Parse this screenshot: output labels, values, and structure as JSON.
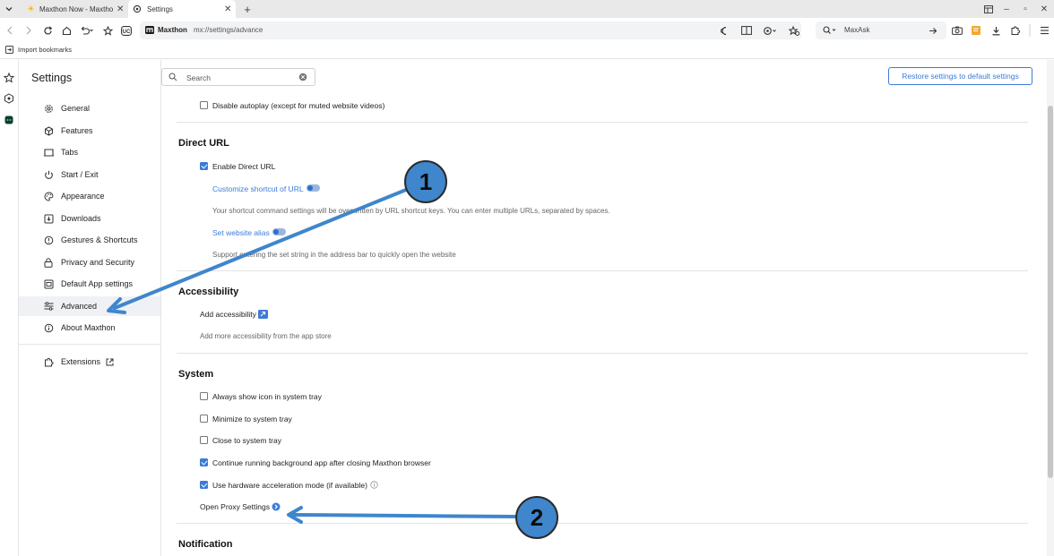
{
  "tabs": [
    {
      "title": "Maxthon Now - Maxtho",
      "active": false
    },
    {
      "title": "Settings",
      "active": true
    }
  ],
  "address": {
    "brand": "Maxthon",
    "url": "mx://settings/advance",
    "search_prefix": "Q",
    "search_placeholder": "MaxAsk"
  },
  "bookmarks": {
    "import_label": "Import bookmarks"
  },
  "nav": {
    "title": "Settings",
    "items": [
      {
        "label": "General",
        "icon": "gear-icon"
      },
      {
        "label": "Features",
        "icon": "cube-icon"
      },
      {
        "label": "Tabs",
        "icon": "tab-icon"
      },
      {
        "label": "Start / Exit",
        "icon": "power-icon"
      },
      {
        "label": "Appearance",
        "icon": "palette-icon"
      },
      {
        "label": "Downloads",
        "icon": "download-icon"
      },
      {
        "label": "Gestures & Shortcuts",
        "icon": "gesture-icon"
      },
      {
        "label": "Privacy and Security",
        "icon": "lock-icon"
      },
      {
        "label": "Default App settings",
        "icon": "app-icon"
      },
      {
        "label": "Advanced",
        "icon": "sliders-icon",
        "active": true
      },
      {
        "label": "About Maxthon",
        "icon": "info-icon"
      }
    ],
    "extensions": "Extensions"
  },
  "main": {
    "search_placeholder": "Search",
    "restore_label": "Restore settings to default settings",
    "autoplay": {
      "label": "Disable autoplay (except for muted website videos)",
      "checked": false
    },
    "direct_url": {
      "header": "Direct URL",
      "enable": {
        "label": "Enable Direct URL",
        "checked": true
      },
      "customize": "Customize shortcut of URL",
      "customize_desc": "Your shortcut command settings will be overwritten by URL shortcut keys. You can enter multiple URLs, separated by spaces.",
      "alias": "Set website alias",
      "alias_desc": "Support entering the set string in the address bar to quickly open the website"
    },
    "accessibility": {
      "header": "Accessibility",
      "add": "Add accessibility",
      "desc": "Add more accessibility from the app store"
    },
    "system": {
      "header": "System",
      "options": [
        {
          "label": "Always show icon in system tray",
          "checked": false
        },
        {
          "label": "Minimize to system tray",
          "checked": false
        },
        {
          "label": "Close to system tray",
          "checked": false
        },
        {
          "label": "Continue running background app after closing Maxthon browser",
          "checked": true
        },
        {
          "label": "Use hardware acceleration mode (if available)",
          "checked": true
        }
      ],
      "proxy": "Open Proxy Settings"
    },
    "notification": {
      "header": "Notification"
    }
  },
  "annotations": {
    "badge1": "1",
    "badge2": "2"
  },
  "colors": {
    "accent": "#3d7bd8",
    "badge": "#3f86cc"
  }
}
